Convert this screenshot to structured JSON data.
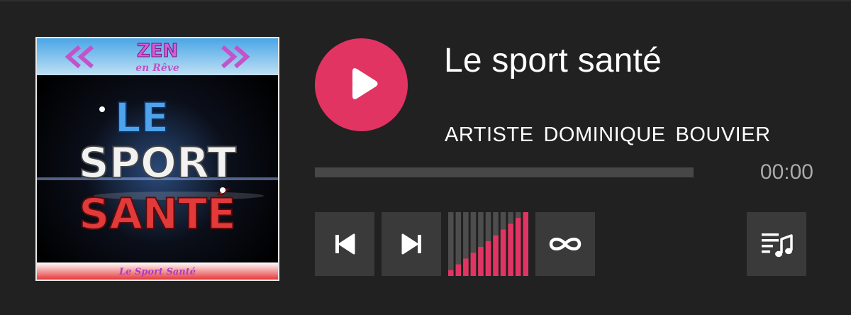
{
  "track": {
    "title": "Le sport santé",
    "artist_words": [
      "ARTISTE",
      "DOMINIQUE",
      "BOUVIER"
    ]
  },
  "cover": {
    "badge_top": "ZEN",
    "badge_bottom": "en Rêve",
    "line1": "LE",
    "line2": "SPORT",
    "line3": "SANTÉ",
    "footer": "Le Sport Santé"
  },
  "player": {
    "elapsed": "00:00",
    "progress_fraction": 0,
    "volume_fraction": 1,
    "volume_bar_count": 11
  },
  "colors": {
    "accent": "#e23462",
    "background": "#212121",
    "button": "#3a3a3a",
    "track": "#474747",
    "inactive_bar": "#4d4d4d"
  },
  "icons": {
    "play": "play-icon",
    "previous": "skip-previous-icon",
    "next": "skip-next-icon",
    "repeat": "repeat-infinity-icon",
    "playlist": "playlist-music-icon"
  }
}
